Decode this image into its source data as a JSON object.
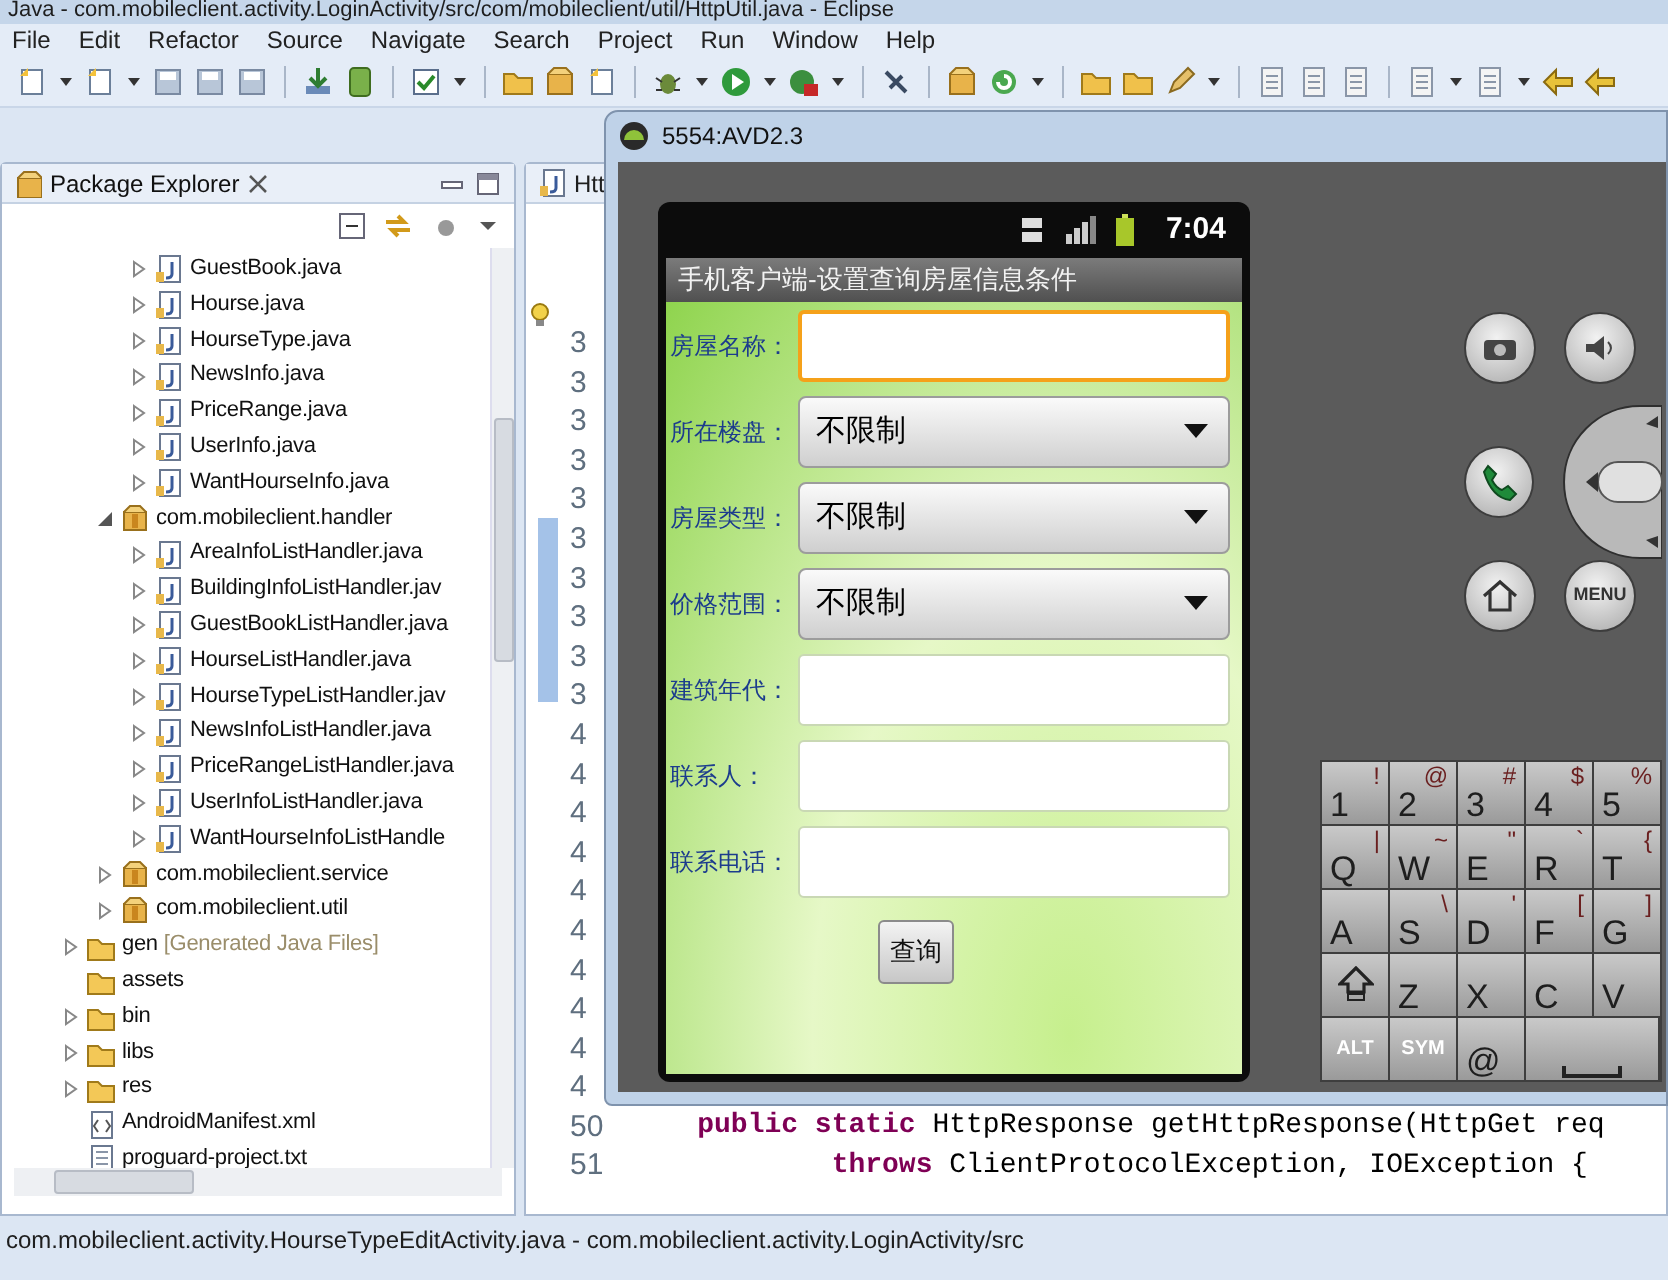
{
  "window": {
    "title": "Java - com.mobileclient.activity.LoginActivity/src/com/mobileclient/util/HttpUtil.java - Eclipse"
  },
  "menu": [
    "File",
    "Edit",
    "Refactor",
    "Source",
    "Navigate",
    "Search",
    "Project",
    "Run",
    "Window",
    "Help"
  ],
  "package_explorer": {
    "title": "Package Explorer",
    "tree": [
      {
        "children": [
          {
            "children": [
              {
                "kind": "java",
                "label": "GuestBook.java",
                "expanded": false
              },
              {
                "kind": "java",
                "label": "Hourse.java",
                "expanded": false
              },
              {
                "kind": "java",
                "label": "HourseType.java",
                "expanded": false
              },
              {
                "kind": "java",
                "label": "NewsInfo.java",
                "expanded": false
              },
              {
                "kind": "java",
                "label": "PriceRange.java",
                "expanded": false
              },
              {
                "kind": "java",
                "label": "UserInfo.java",
                "expanded": false
              },
              {
                "kind": "java",
                "label": "WantHourseInfo.java",
                "expanded": false
              }
            ]
          },
          {
            "kind": "package",
            "label": "com.mobileclient.handler",
            "expanded": true,
            "children": [
              {
                "kind": "java",
                "label": "AreaInfoListHandler.java",
                "expanded": false
              },
              {
                "kind": "java",
                "label": "BuildingInfoListHandler.jav",
                "expanded": false
              },
              {
                "kind": "java",
                "label": "GuestBookListHandler.java",
                "expanded": false
              },
              {
                "kind": "java",
                "label": "HourseListHandler.java",
                "expanded": false
              },
              {
                "kind": "java",
                "label": "HourseTypeListHandler.jav",
                "expanded": false
              },
              {
                "kind": "java",
                "label": "NewsInfoListHandler.java",
                "expanded": false
              },
              {
                "kind": "java",
                "label": "PriceRangeListHandler.java",
                "expanded": false
              },
              {
                "kind": "java",
                "label": "UserInfoListHandler.java",
                "expanded": false
              },
              {
                "kind": "java",
                "label": "WantHourseInfoListHandle",
                "expanded": false
              }
            ]
          },
          {
            "kind": "package",
            "label": "com.mobileclient.service",
            "expanded": false
          },
          {
            "kind": "package",
            "label": "com.mobileclient.util",
            "expanded": false
          }
        ]
      },
      {
        "kind": "folder",
        "label": "gen",
        "decoration": "[Generated Java Files]",
        "expanded": false
      },
      {
        "kind": "folder",
        "label": "assets"
      },
      {
        "kind": "folder",
        "label": "bin",
        "expanded": false
      },
      {
        "kind": "folder",
        "label": "libs",
        "expanded": false
      },
      {
        "kind": "folder",
        "label": "res",
        "expanded": false
      },
      {
        "kind": "xml",
        "label": "AndroidManifest.xml"
      },
      {
        "kind": "text",
        "label": "proguard-project.txt"
      }
    ]
  },
  "editor": {
    "tab": "Htt",
    "lines": [
      {
        "number": "3"
      },
      {
        "number": "3"
      },
      {
        "number": "3"
      },
      {
        "number": "3"
      },
      {
        "number": "3"
      },
      {
        "number": "3"
      },
      {
        "number": "3"
      },
      {
        "number": "3"
      },
      {
        "number": "3"
      },
      {
        "number": "3"
      },
      {
        "number": "4"
      },
      {
        "number": "4"
      },
      {
        "number": "4"
      },
      {
        "number": "4"
      },
      {
        "number": "4"
      },
      {
        "number": "4"
      },
      {
        "number": "4"
      },
      {
        "number": "4"
      },
      {
        "number": "4"
      },
      {
        "number": "4"
      },
      {
        "number": "50",
        "code": "    **public static** HttpResponse getHttpResponse(HttpGet req"
      },
      {
        "number": "51",
        "code": "            **throws** ClientProtocolException, IOException {"
      }
    ]
  },
  "emulator": {
    "title": "5554:AVD2.3",
    "screen": {
      "time": "7:04",
      "app_title": "手机客户端-设置查询房屋信息条件",
      "form": [
        {
          "kind": "text",
          "label": "房屋名称：",
          "focused": true
        },
        {
          "kind": "spinner",
          "label": "所在楼盘：",
          "value": "不限制"
        },
        {
          "kind": "spinner",
          "label": "房屋类型：",
          "value": "不限制"
        },
        {
          "kind": "spinner",
          "label": "价格范围：",
          "value": "不限制"
        },
        {
          "kind": "text",
          "label": "建筑年代：",
          "focused": false
        },
        {
          "kind": "text",
          "label": "联系人：",
          "focused": false
        },
        {
          "kind": "text",
          "label": "联系电话：",
          "focused": false
        }
      ],
      "button": "查询"
    },
    "menu_button": "MENU",
    "keyboard": [
      {
        "keys": [
          {
            "kind": "char",
            "main": "1",
            "alt": "!"
          },
          {
            "kind": "char",
            "main": "2",
            "alt": "@"
          },
          {
            "kind": "char",
            "main": "3",
            "alt": "#"
          },
          {
            "kind": "char",
            "main": "4",
            "alt": "$"
          },
          {
            "kind": "char",
            "main": "5",
            "alt": "%"
          }
        ]
      },
      {
        "keys": [
          {
            "kind": "char",
            "main": "Q",
            "alt": "|"
          },
          {
            "kind": "char",
            "main": "W",
            "alt": "~"
          },
          {
            "kind": "char",
            "main": "E",
            "alt": "\""
          },
          {
            "kind": "char",
            "main": "R",
            "alt": "`"
          },
          {
            "kind": "char",
            "main": "T",
            "alt": "{"
          }
        ]
      },
      {
        "keys": [
          {
            "kind": "char",
            "main": "A"
          },
          {
            "kind": "char",
            "main": "S",
            "alt": "\\"
          },
          {
            "kind": "char",
            "main": "D",
            "alt": "'"
          },
          {
            "kind": "char",
            "main": "F",
            "alt": "["
          },
          {
            "kind": "char",
            "main": "G",
            "alt": "]"
          }
        ]
      },
      {
        "keys": [
          {
            "kind": "shift"
          },
          {
            "kind": "char",
            "main": "Z"
          },
          {
            "kind": "char",
            "main": "X"
          },
          {
            "kind": "char",
            "main": "C"
          },
          {
            "kind": "char",
            "main": "V"
          }
        ]
      },
      {
        "keys": [
          {
            "kind": "label",
            "main": "ALT"
          },
          {
            "kind": "label",
            "main": "SYM"
          },
          {
            "kind": "char",
            "main": "@"
          },
          {
            "kind": "space"
          }
        ]
      }
    ]
  },
  "status_bar": "com.mobileclient.activity.HourseTypeEditActivity.java - com.mobileclient.activity.LoginActivity/src"
}
